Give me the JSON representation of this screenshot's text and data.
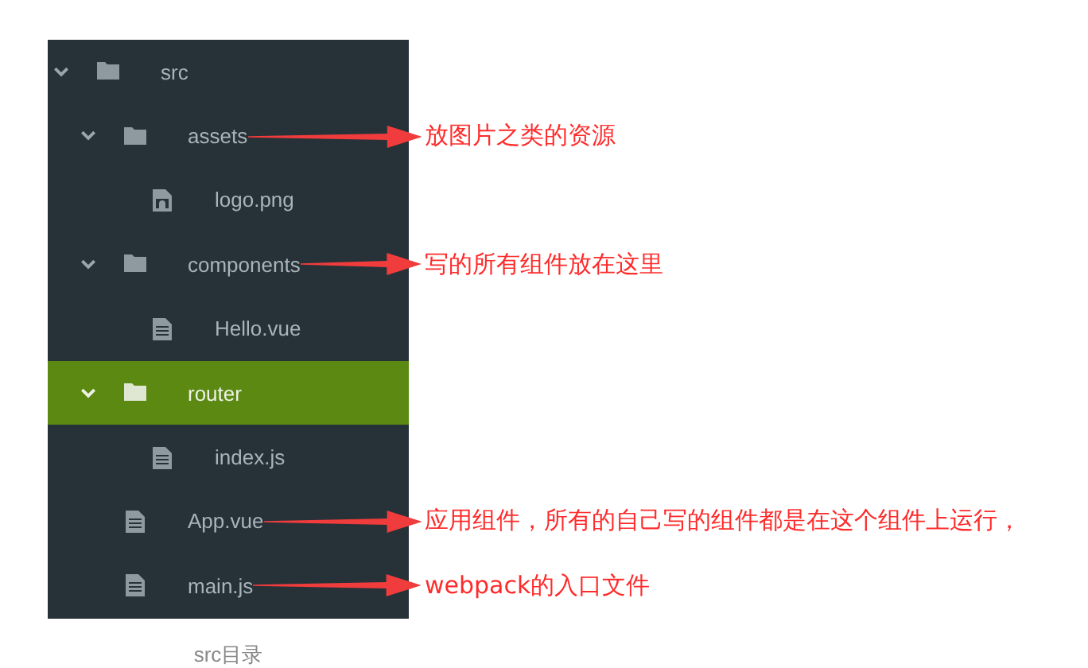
{
  "tree": [
    {
      "kind": "folder",
      "name": "src",
      "expanded": true,
      "selected": false,
      "children": [
        {
          "kind": "folder",
          "name": "assets",
          "expanded": true,
          "selected": false,
          "note": "放图片之类的资源",
          "children": [
            {
              "kind": "image",
              "name": "logo.png",
              "selected": false
            }
          ]
        },
        {
          "kind": "folder",
          "name": "components",
          "expanded": true,
          "selected": false,
          "note": "写的所有组件放在这里",
          "children": [
            {
              "kind": "file",
              "name": "Hello.vue",
              "selected": false
            }
          ]
        },
        {
          "kind": "folder",
          "name": "router",
          "expanded": true,
          "selected": true,
          "children": [
            {
              "kind": "file",
              "name": "index.js",
              "selected": false
            }
          ]
        },
        {
          "kind": "file",
          "name": "App.vue",
          "selected": false,
          "note": "应用组件，所有的自己写的组件都是在这个组件上运行，"
        },
        {
          "kind": "file",
          "name": "main.js",
          "selected": false,
          "note": "webpack的入口文件"
        }
      ]
    }
  ],
  "caption": "src目录"
}
